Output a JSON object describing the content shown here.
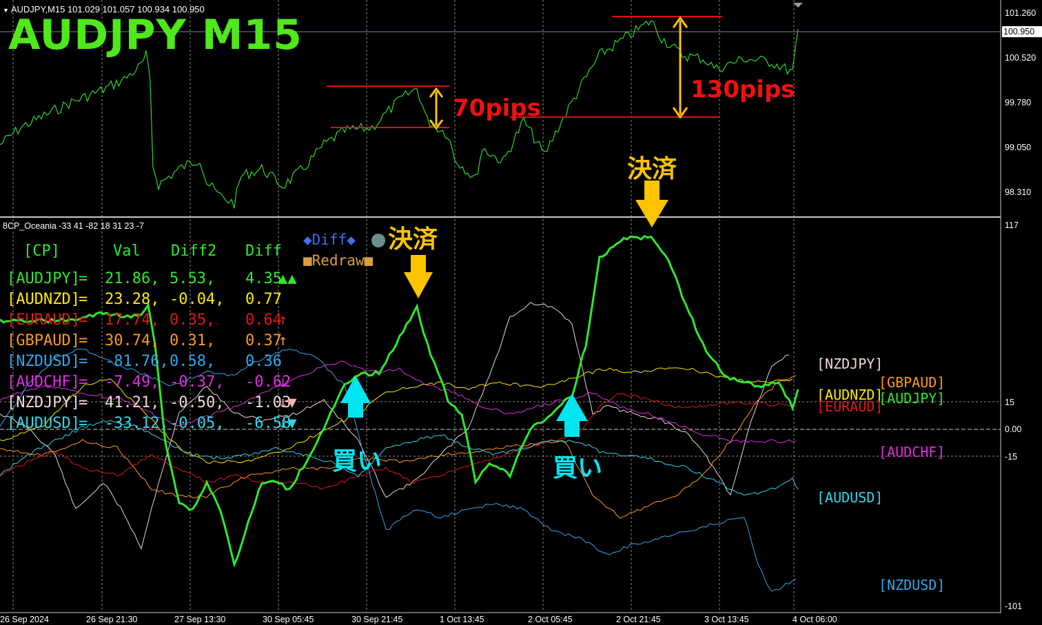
{
  "main_header": "AUDJPY,M15  101.029 101.057 100.934 100.950",
  "title_overlay": "AUDJPY  M15",
  "current_price": "100.950",
  "price_axis": [
    "101.260",
    "100.520",
    "99.780",
    "99.050",
    "98.310"
  ],
  "annotations": {
    "pips_small": "70pips",
    "pips_large": "130pips",
    "kessai": "決済",
    "kai": "買い"
  },
  "indicator_header": "8CP_Oceania -33 41 -82 18 31 23 -7",
  "indicator_axis": [
    "117",
    "15",
    "0.00",
    "-15",
    "-101"
  ],
  "buttons": {
    "diff": "◆Diff◆",
    "redraw": "■Redraw■"
  },
  "table": {
    "headers": [
      "[CP]",
      "Val",
      "Diff2",
      "Diff"
    ],
    "rows": [
      {
        "pair": "[AUDJPY]",
        "val": "21.86,",
        "diff2": "5.53,",
        "diff": "4.35",
        "mark": "▲▲",
        "color": "#2ee82e",
        "mark_color": "#2ee82e"
      },
      {
        "pair": "[AUDNZD]",
        "val": "23.28,",
        "diff2": "-0.04,",
        "diff": "0.77",
        "mark": "",
        "color": "#ffea00",
        "mark_color": "#ffea00"
      },
      {
        "pair": "[EURAUD]",
        "val": "17.74,",
        "diff2": "0.35,",
        "diff": "0.64",
        "mark": "↑",
        "color": "#e01818",
        "mark_color": "#e01818"
      },
      {
        "pair": "[GBPAUD]",
        "val": "30.74,",
        "diff2": "0.31,",
        "diff": "0.37",
        "mark": "↑",
        "color": "#ff9a1e",
        "mark_color": "#ff9a1e"
      },
      {
        "pair": "[NZDUSD]",
        "val": "-81.76,",
        "diff2": "0.58,",
        "diff": "0.36",
        "mark": "",
        "color": "#2fa8ee",
        "mark_color": "#2fa8ee"
      },
      {
        "pair": "[AUDCHF]",
        "val": "-7.49,",
        "diff2": "-0.37,",
        "diff": "-0.62",
        "mark": "↓",
        "color": "#e02ee0",
        "mark_color": "#e02ee0"
      },
      {
        "pair": "[NZDJPY]",
        "val": "41.21,",
        "diff2": "-0.50,",
        "diff": "-1.03",
        "mark": "↓▼",
        "color": "#f3d6d6",
        "mark_color": "#ffb0b0"
      },
      {
        "pair": "[AUDUSD]",
        "val": "-33.12,",
        "diff2": "-0.05,",
        "diff": "-6.58",
        "mark": "↓▼",
        "color": "#2ed8e8",
        "mark_color": "#2ed8e8"
      }
    ]
  },
  "right_labels": [
    {
      "text": "[NZDJPY]",
      "color": "#f3d6d6"
    },
    {
      "text": "[GBPAUD]",
      "color": "#ff9a1e"
    },
    {
      "text": "[AUDNZD]",
      "color": "#ffea00"
    },
    {
      "text": "[AUDJPY]",
      "color": "#2ee82e"
    },
    {
      "text": "[EURAUD]",
      "color": "#e01818"
    },
    {
      "text": "[AUDCHF]",
      "color": "#e02ee0"
    },
    {
      "text": "[AUDUSD]",
      "color": "#2ed8e8"
    },
    {
      "text": "[NZDUSD]",
      "color": "#2fa8ee"
    }
  ],
  "time_axis": [
    "26 Sep 2024",
    "26 Sep 21:30",
    "27 Sep 13:30",
    "30 Sep 05:45",
    "30 Sep 21:45",
    "1 Oct 13:45",
    "2 Oct 05:45",
    "2 Oct 21:45",
    "3 Oct 13:45",
    "4 Oct 06:00"
  ],
  "colors": {
    "price_line": "#2fd62f",
    "level_line": "#e01010",
    "arrow_gold": "#ffc400",
    "arrow_cyan": "#00e6f0",
    "grid": "#8a8a8a"
  }
}
